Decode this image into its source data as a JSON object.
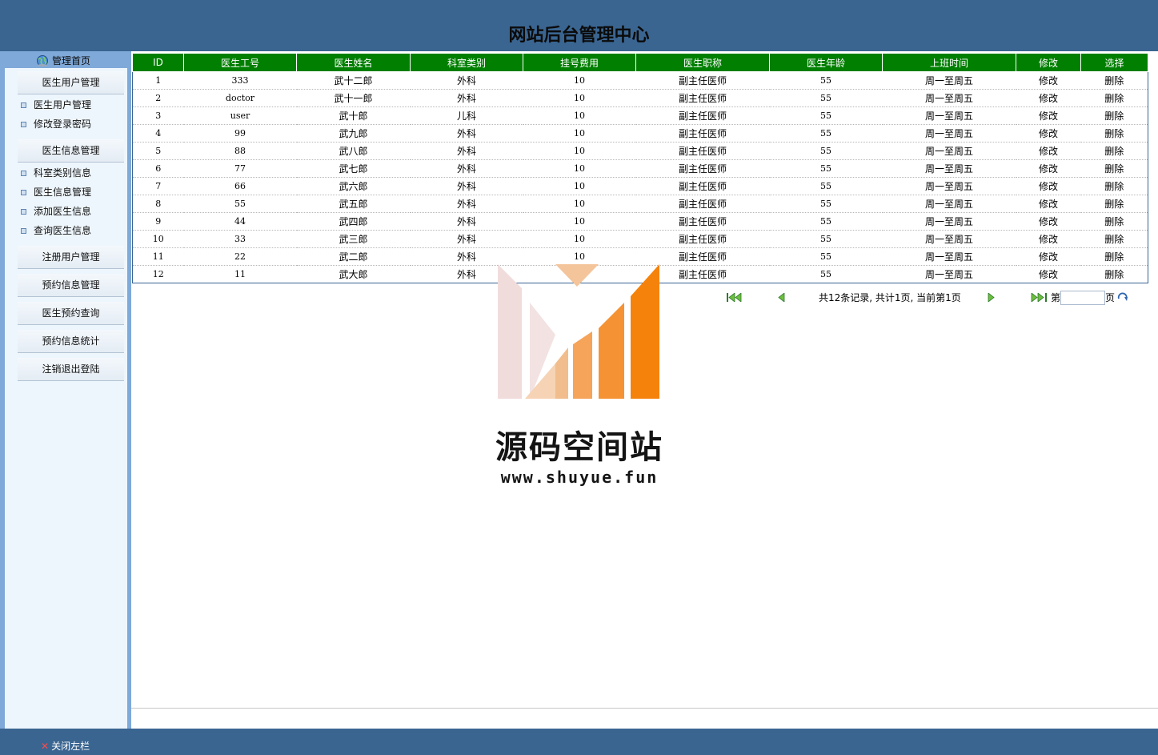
{
  "header": {
    "title": "网站后台管理中心"
  },
  "sidebar": {
    "home_label": "管理首页",
    "groups": [
      {
        "label": "医生用户管理",
        "items": [
          "医生用户管理",
          "修改登录密码"
        ]
      },
      {
        "label": "医生信息管理",
        "items": [
          "科室类别信息",
          "医生信息管理",
          "添加医生信息",
          "查询医生信息"
        ]
      },
      {
        "label": "注册用户管理"
      },
      {
        "label": "预约信息管理"
      },
      {
        "label": "医生预约查询"
      },
      {
        "label": "预约信息统计"
      },
      {
        "label": "注销退出登陆"
      }
    ]
  },
  "table": {
    "columns": [
      "ID",
      "医生工号",
      "医生姓名",
      "科室类别",
      "挂号费用",
      "医生职称",
      "医生年龄",
      "上班时间",
      "修改",
      "选择"
    ],
    "rows": [
      [
        "1",
        "333",
        "武十二郎",
        "外科",
        "10",
        "副主任医师",
        "55",
        "周一至周五",
        "修改",
        "删除"
      ],
      [
        "2",
        "doctor",
        "武十一郎",
        "外科",
        "10",
        "副主任医师",
        "55",
        "周一至周五",
        "修改",
        "删除"
      ],
      [
        "3",
        "user",
        "武十郎",
        "儿科",
        "10",
        "副主任医师",
        "55",
        "周一至周五",
        "修改",
        "删除"
      ],
      [
        "4",
        "99",
        "武九郎",
        "外科",
        "10",
        "副主任医师",
        "55",
        "周一至周五",
        "修改",
        "删除"
      ],
      [
        "5",
        "88",
        "武八郎",
        "外科",
        "10",
        "副主任医师",
        "55",
        "周一至周五",
        "修改",
        "删除"
      ],
      [
        "6",
        "77",
        "武七郎",
        "外科",
        "10",
        "副主任医师",
        "55",
        "周一至周五",
        "修改",
        "删除"
      ],
      [
        "7",
        "66",
        "武六郎",
        "外科",
        "10",
        "副主任医师",
        "55",
        "周一至周五",
        "修改",
        "删除"
      ],
      [
        "8",
        "55",
        "武五郎",
        "外科",
        "10",
        "副主任医师",
        "55",
        "周一至周五",
        "修改",
        "删除"
      ],
      [
        "9",
        "44",
        "武四郎",
        "外科",
        "10",
        "副主任医师",
        "55",
        "周一至周五",
        "修改",
        "删除"
      ],
      [
        "10",
        "33",
        "武三郎",
        "外科",
        "10",
        "副主任医师",
        "55",
        "周一至周五",
        "修改",
        "删除"
      ],
      [
        "11",
        "22",
        "武二郎",
        "外科",
        "10",
        "副主任医师",
        "55",
        "周一至周五",
        "修改",
        "删除"
      ],
      [
        "12",
        "11",
        "武大郎",
        "外科",
        "",
        "副主任医师",
        "55",
        "周一至周五",
        "修改",
        "删除"
      ]
    ]
  },
  "pager": {
    "info": "共12条记录, 共计1页, 当前第1页",
    "page_prefix": "第",
    "page_suffix": "页",
    "page_value": ""
  },
  "watermark": {
    "name": "源码空间站",
    "url": "www.shuyue.fun"
  },
  "footer": {
    "close_label": "关闭左栏"
  },
  "colors": {
    "frame_blue": "#3a6591",
    "sidebar_blue": "#7fa9d9",
    "header_green": "#007f00",
    "accent_orange": "#f5820a"
  }
}
